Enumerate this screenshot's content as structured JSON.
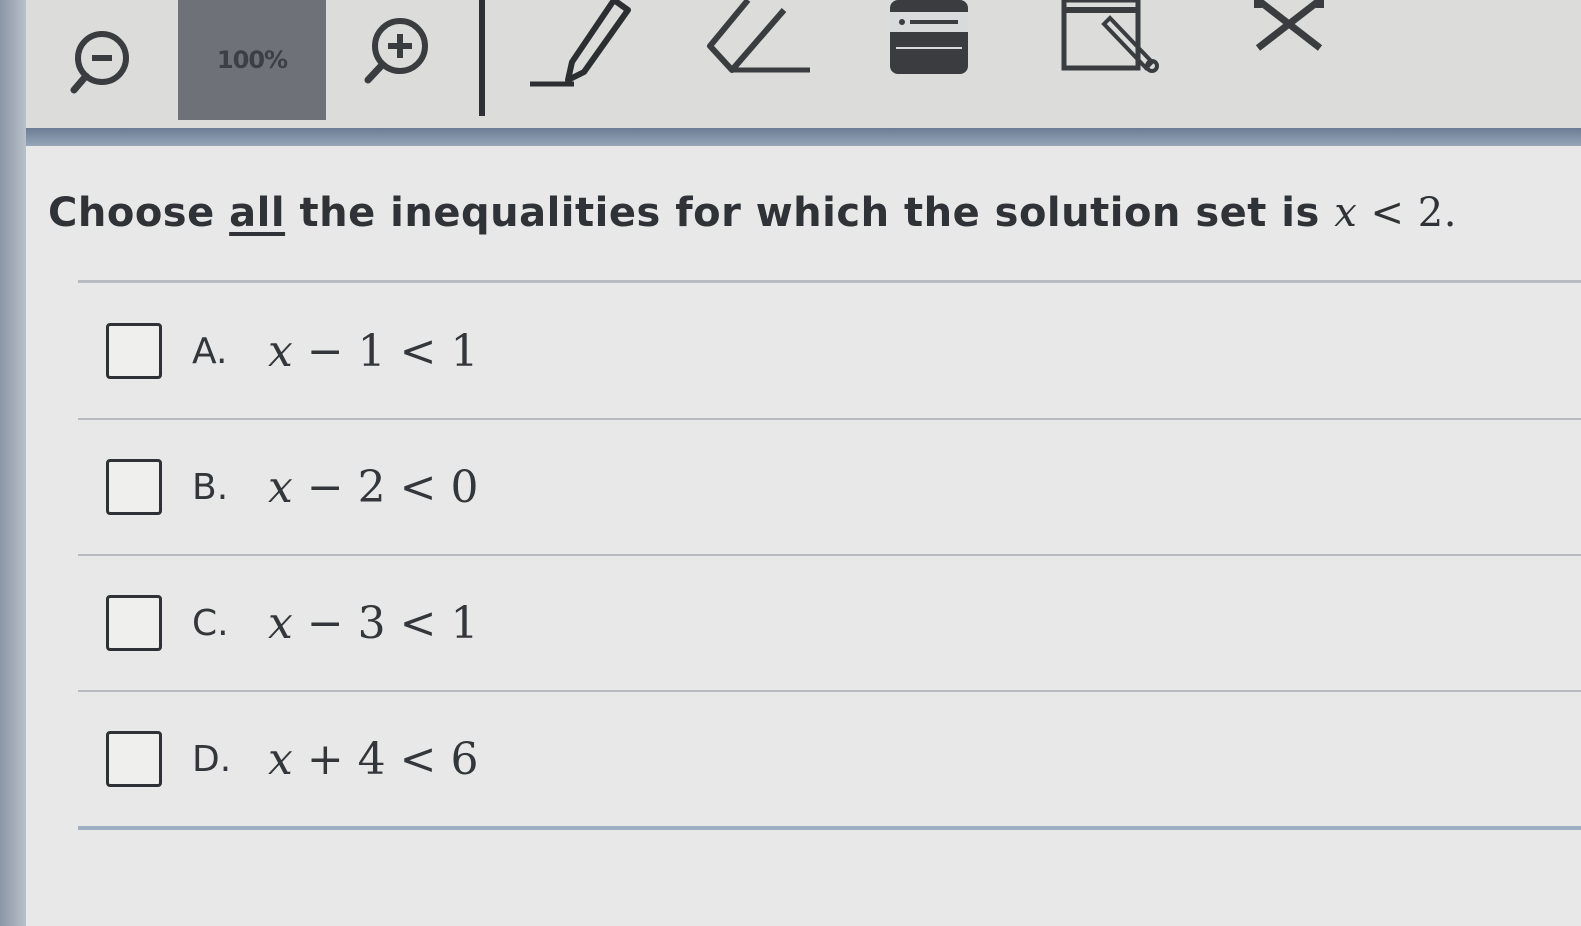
{
  "toolbar": {
    "zoom_level": "100%",
    "tools": [
      {
        "name": "zoom-out-icon"
      },
      {
        "name": "zoom-in-icon"
      },
      {
        "name": "pencil-icon"
      },
      {
        "name": "eraser-icon"
      },
      {
        "name": "line-reader-icon"
      },
      {
        "name": "highlighter-icon"
      },
      {
        "name": "cross-out-icon"
      }
    ]
  },
  "question": {
    "prefix": "Choose ",
    "emphasis": "all",
    "middle": " the inequalities for which the solution set is ",
    "math_var": "x",
    "math_rest": " < 2."
  },
  "options": [
    {
      "letter": "A.",
      "var": "x",
      "rest": " − 1 < 1"
    },
    {
      "letter": "B.",
      "var": "x",
      "rest": " − 2 < 0"
    },
    {
      "letter": "C.",
      "var": "x",
      "rest": " − 3 < 1"
    },
    {
      "letter": "D.",
      "var": "x",
      "rest": " + 4 < 6"
    }
  ]
}
